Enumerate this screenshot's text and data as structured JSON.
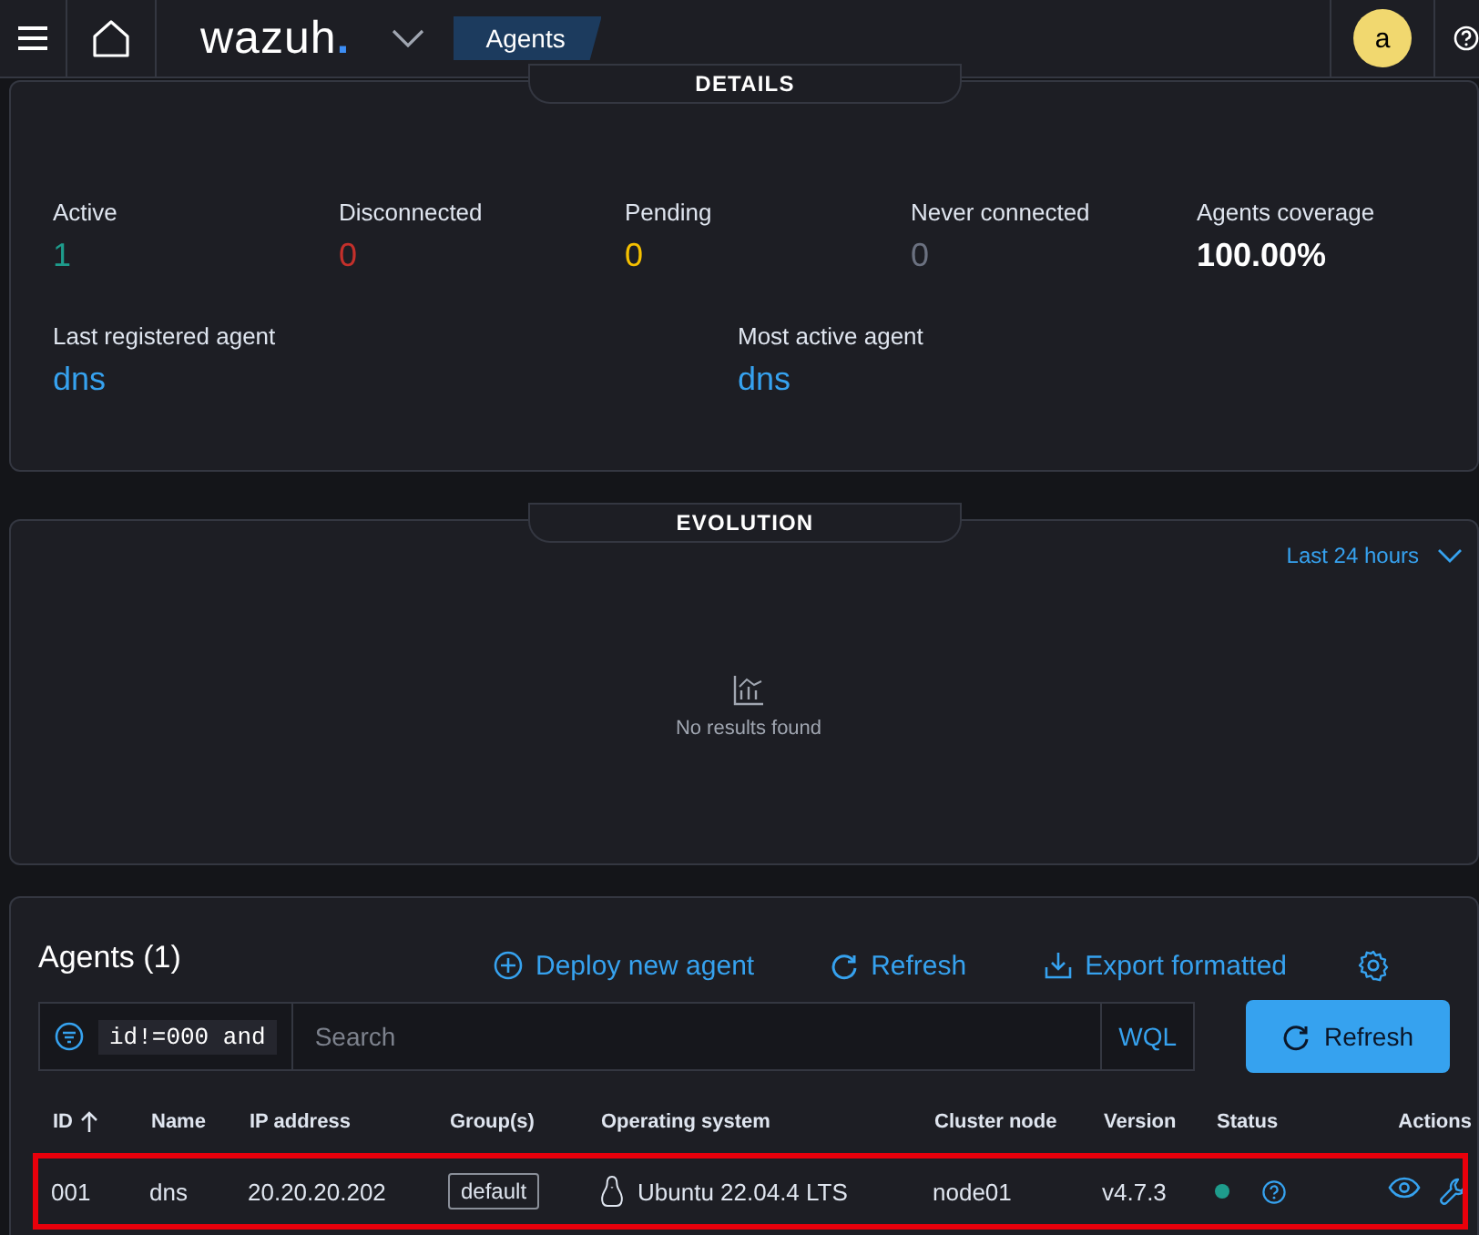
{
  "header": {
    "brand": {
      "name": "wazuh",
      "mark": "."
    },
    "breadcrumb": "Agents",
    "avatar": "a"
  },
  "details": {
    "title": "DETAILS",
    "stats": [
      {
        "label": "Active",
        "value": "1",
        "color": "#1e9c8c"
      },
      {
        "label": "Disconnected",
        "value": "0",
        "color": "#c4302b"
      },
      {
        "label": "Pending",
        "value": "0",
        "color": "#f5c000"
      },
      {
        "label": "Never connected",
        "value": "0",
        "color": "#6b7180"
      },
      {
        "label": "Agents coverage",
        "value": "100.00%",
        "color": "#ffffff"
      }
    ],
    "links": [
      {
        "label": "Last registered agent",
        "value": "dns"
      },
      {
        "label": "Most active agent",
        "value": "dns"
      }
    ]
  },
  "evolution": {
    "title": "EVOLUTION",
    "range": "Last 24 hours",
    "empty": "No results found"
  },
  "agents": {
    "title": "Agents (1)",
    "actions": [
      {
        "kind": "add",
        "label": "Deploy new agent"
      },
      {
        "kind": "refresh",
        "label": "Refresh"
      },
      {
        "kind": "export",
        "label": "Export formatted"
      }
    ],
    "filter": "id!=000 and",
    "search": {
      "placeholder": "Search"
    },
    "wql": "WQL",
    "refresh": "Refresh",
    "columns": [
      {
        "label": "ID",
        "sorted": true
      },
      {
        "label": "Name",
        "sorted": false
      },
      {
        "label": "IP address",
        "sorted": false
      },
      {
        "label": "Group(s)",
        "sorted": false
      },
      {
        "label": "Operating system",
        "sorted": false
      },
      {
        "label": "Cluster node",
        "sorted": false
      },
      {
        "label": "Version",
        "sorted": false
      },
      {
        "label": "Status",
        "sorted": false
      },
      {
        "label": "Actions",
        "sorted": false
      }
    ],
    "rows": [
      {
        "id": "001",
        "name": "dns",
        "ip": "20.20.20.202",
        "group": "default",
        "os": "Ubuntu 22.04.4 LTS",
        "node": "node01",
        "version": "v4.7.3",
        "status": {
          "color": "#1e9c8c"
        },
        "highlighted": true
      }
    ]
  }
}
